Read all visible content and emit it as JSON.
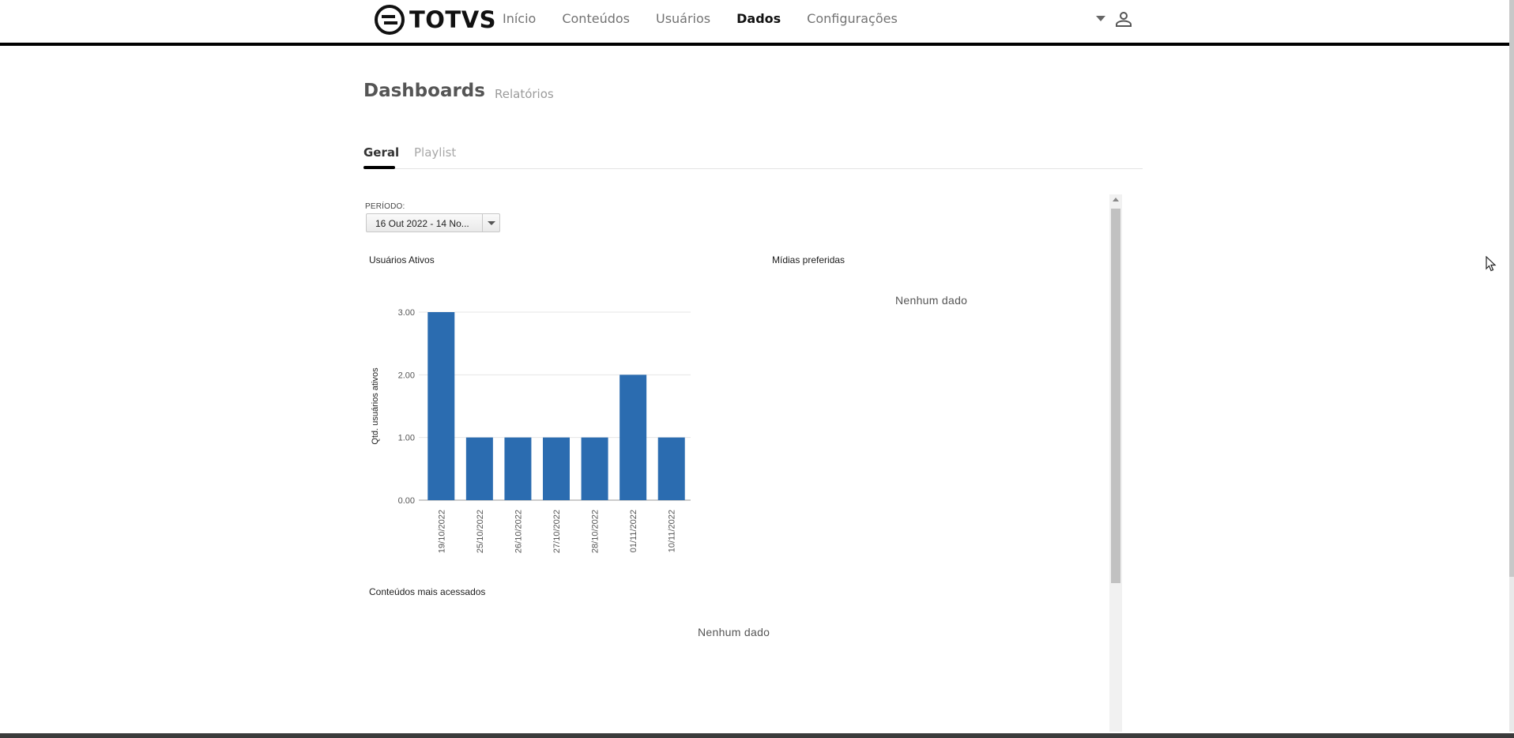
{
  "brand": {
    "name": "TOTVS"
  },
  "nav": {
    "items": [
      {
        "label": "Início",
        "active": false
      },
      {
        "label": "Conteúdos",
        "active": false
      },
      {
        "label": "Usuários",
        "active": false
      },
      {
        "label": "Dados",
        "active": true
      },
      {
        "label": "Configurações",
        "active": false
      }
    ],
    "icons": [
      "chevron-down-icon",
      "user-icon"
    ]
  },
  "header": {
    "title": "Dashboards",
    "secondary_tab": "Relatórios"
  },
  "tabs": [
    {
      "label": "Geral",
      "active": true
    },
    {
      "label": "Playlist",
      "active": false
    }
  ],
  "filters": {
    "period_label": "PERÍODO:",
    "period_value": "16 Out 2022 - 14 No..."
  },
  "widgets": {
    "active_users": {
      "title": "Usuários Ativos"
    },
    "preferred_media": {
      "title": "Mídias preferidas",
      "empty_text": "Nenhum dado"
    },
    "top_content": {
      "title": "Conteúdos mais acessados",
      "empty_text": "Nenhum dado"
    }
  },
  "colors": {
    "bar": "#2b6cb0",
    "accent": "#000000",
    "nav_active": "#111111",
    "muted": "#9b9b9b"
  },
  "chart_data": {
    "type": "bar",
    "title": "Usuários Ativos",
    "xlabel": "",
    "ylabel": "Qtd. usuários ativos",
    "categories": [
      "19/10/2022",
      "25/10/2022",
      "26/10/2022",
      "27/10/2022",
      "28/10/2022",
      "01/11/2022",
      "10/11/2022"
    ],
    "values": [
      3,
      1,
      1,
      1,
      1,
      2,
      1
    ],
    "yticks": [
      "0.00",
      "1.00",
      "2.00",
      "3.00"
    ],
    "ylim": [
      0,
      3
    ],
    "grid": true,
    "legend": "none"
  }
}
